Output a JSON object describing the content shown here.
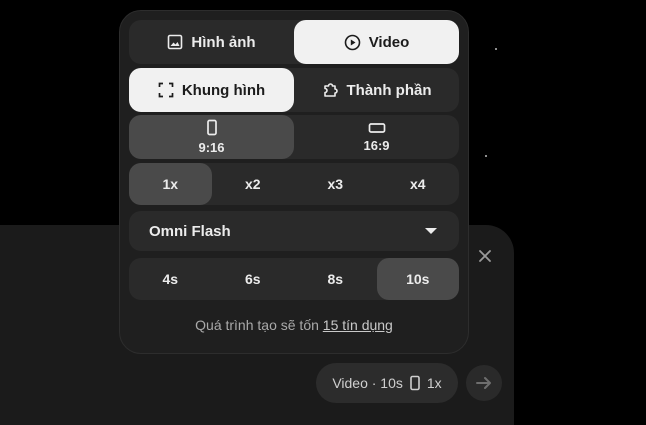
{
  "popover": {
    "media_type": {
      "options": [
        {
          "label": "Hình ảnh",
          "icon": "image-icon"
        },
        {
          "label": "Video",
          "icon": "play-circle-icon"
        }
      ],
      "selected": "Video"
    },
    "mode": {
      "options": [
        {
          "label": "Khung hình",
          "icon": "frame-icon"
        },
        {
          "label": "Thành phần",
          "icon": "puzzle-icon"
        }
      ],
      "selected": "Khung hình"
    },
    "aspect_ratio": {
      "options": [
        {
          "label": "9:16",
          "icon": "portrait-icon"
        },
        {
          "label": "16:9",
          "icon": "landscape-icon"
        }
      ],
      "selected": "9:16"
    },
    "quantity": {
      "options": [
        "1x",
        "x2",
        "x3",
        "x4"
      ],
      "selected": "1x"
    },
    "model": {
      "selected": "Omni Flash",
      "icon": "caret-down-icon"
    },
    "duration": {
      "options": [
        "4s",
        "6s",
        "8s",
        "10s"
      ],
      "selected": "10s"
    },
    "cost": {
      "text": "Quá trình tạo sẽ tốn",
      "link": "15 tín dụng"
    }
  },
  "composer": {
    "summary": {
      "label": "Video · 10s",
      "count": "1x",
      "icon": "portrait-icon"
    },
    "close_icon": "close-icon",
    "send_icon": "arrow-right-icon"
  },
  "colors": {
    "background": "#000000",
    "panel": "#1f1f1f",
    "segment": "#2a2a2a",
    "selected_light": "#f1f1f1",
    "selected_dark": "#4a4a4a"
  }
}
